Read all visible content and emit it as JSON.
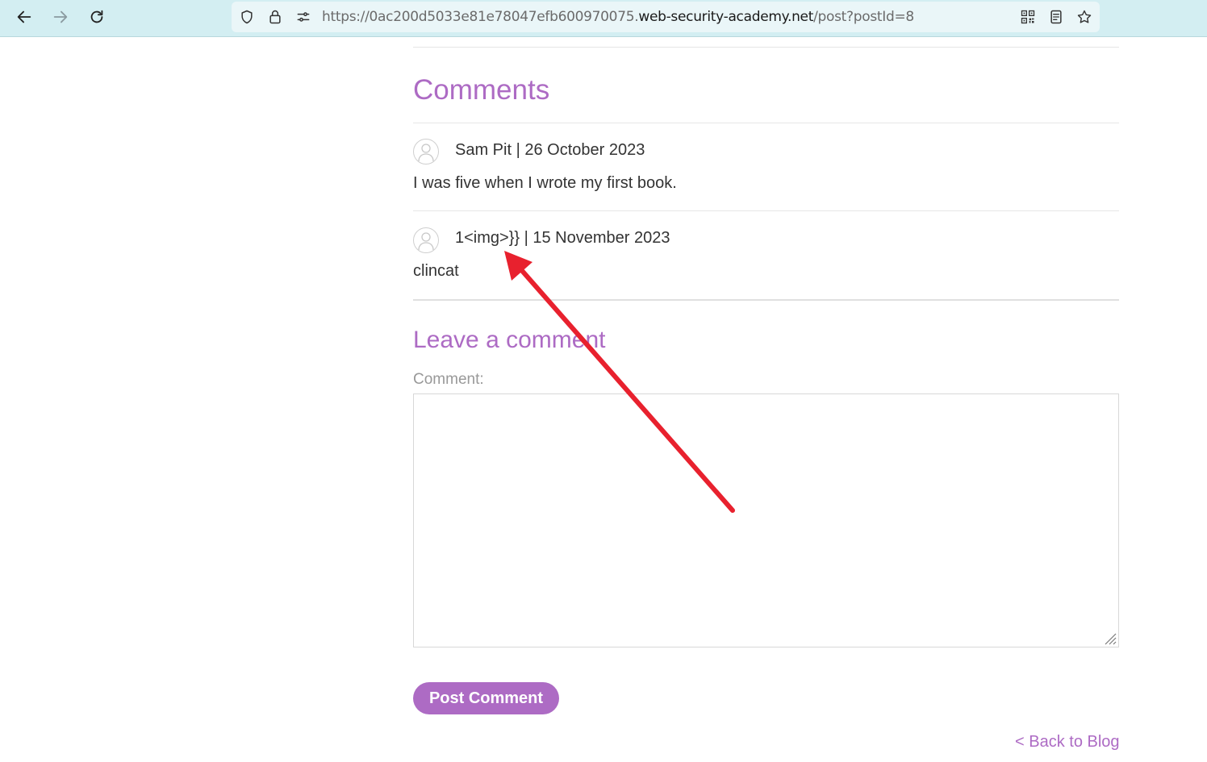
{
  "browser": {
    "url_prefix": "https://0ac200d5033e81e78047efb600970075.",
    "url_domain": "web-security-academy.net",
    "url_path": "/post?postId=8",
    "icons": [
      "back-arrow-icon",
      "forward-arrow-icon",
      "reload-icon",
      "shield-icon",
      "lock-icon",
      "permissions-icon",
      "qr-code-icon",
      "reader-view-icon",
      "bookmark-star-icon"
    ]
  },
  "comments_section": {
    "heading": "Comments",
    "comments": [
      {
        "author_line": "Sam Pit | 26 October 2023",
        "text": "I was five when I wrote my first book."
      },
      {
        "author_line": "1<img>}} | 15 November 2023",
        "text": "clincat"
      }
    ]
  },
  "leave_comment": {
    "heading": "Leave a comment",
    "comment_label": "Comment:",
    "comment_value": "",
    "submit_label": "Post Comment"
  },
  "footer": {
    "back_link": "< Back to Blog"
  },
  "annotation": {
    "type": "red-arrow",
    "color": "#e8212e",
    "points_to": "second comment author"
  },
  "colors": {
    "accent": "#ad6bc4",
    "toolbar": "#d3eef2",
    "text": "#333333"
  }
}
